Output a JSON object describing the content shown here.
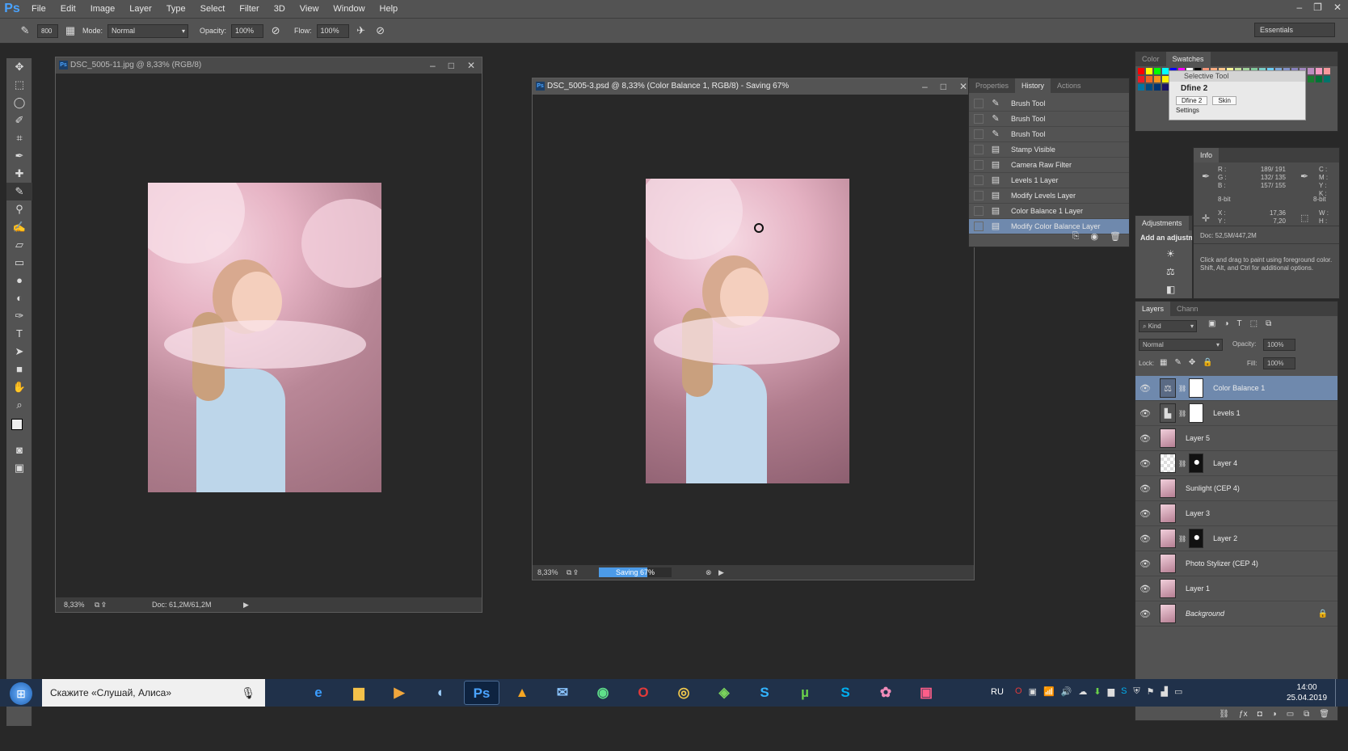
{
  "app": {
    "logo": "Ps"
  },
  "menubar": {
    "items": [
      "File",
      "Edit",
      "Image",
      "Layer",
      "Type",
      "Select",
      "Filter",
      "3D",
      "View",
      "Window",
      "Help"
    ]
  },
  "options": {
    "brush_size": "800",
    "mode_label": "Mode:",
    "mode_value": "Normal",
    "opacity_label": "Opacity:",
    "opacity_value": "100%",
    "flow_label": "Flow:",
    "flow_value": "100%",
    "workspace": "Essentials"
  },
  "doc1": {
    "title": "DSC_5005-11.jpg @ 8,33% (RGB/8)",
    "zoom": "8,33%",
    "doc_info": "Doc: 61,2M/61,2M"
  },
  "doc2": {
    "title": "DSC_5005-3.psd @ 8,33% (Color Balance 1, RGB/8) - Saving 67%",
    "zoom": "8,33%",
    "progress_label": "Saving 67%",
    "progress": 0.67
  },
  "history_panel": {
    "tabs": [
      "Properties",
      "History",
      "Actions"
    ],
    "items": [
      "Brush Tool",
      "Brush Tool",
      "Brush Tool",
      "Stamp Visible",
      "Camera Raw Filter",
      "Levels 1 Layer",
      "Modify Levels Layer",
      "Color Balance 1 Layer",
      "Modify Color Balance Layer"
    ]
  },
  "swatches_panel": {
    "tabs": [
      "Color",
      "Swatches"
    ]
  },
  "selective_tool": {
    "title": "Selective Tool",
    "preset": "Dfine 2",
    "button1": "Dfine 2",
    "button2": "Skin",
    "settings": "Settings"
  },
  "info_panel": {
    "tab": "Info",
    "r_label": "R :",
    "g_label": "G :",
    "b_label": "B :",
    "r_value": "189/ 191",
    "g_value": "132/ 135",
    "b_value": "157/ 155",
    "c_label": "C :",
    "m_label": "M :",
    "y_label": "Y :",
    "k_label": "K :",
    "bit1": "8-bit",
    "bit2": "8-bit",
    "x_label": "X :",
    "y2_label": "Y :",
    "x_value": "17,36",
    "y_value": "7,20",
    "w_label": "W :",
    "h_label": "H :",
    "doc": "Doc: 52,5M/447,2M",
    "hint1": "Click and drag to paint using foreground color.",
    "hint2": "Shift, Alt, and Ctrl for additional options."
  },
  "adjustments_panel": {
    "tab": "Adjustments",
    "add_label": "Add an adjustment"
  },
  "layers_panel": {
    "tabs": [
      "Layers",
      "Channels"
    ],
    "kind": "Kind",
    "blend": "Normal",
    "opacity_label": "Opacity:",
    "opacity_value": "100%",
    "lock_label": "Lock:",
    "fill_label": "Fill:",
    "fill_value": "100%",
    "layers": [
      "Color Balance 1",
      "Levels 1",
      "Layer 5",
      "Layer 4",
      "Sunlight (CEP 4)",
      "Layer 3",
      "Layer 2",
      "Photo Stylizer (CEP 4)",
      "Layer 1",
      "Background"
    ]
  },
  "taskbar": {
    "search": "Скажите «Слушай, Алиса»",
    "lang": "RU",
    "time": "14:00",
    "date": "25.04.2019"
  }
}
